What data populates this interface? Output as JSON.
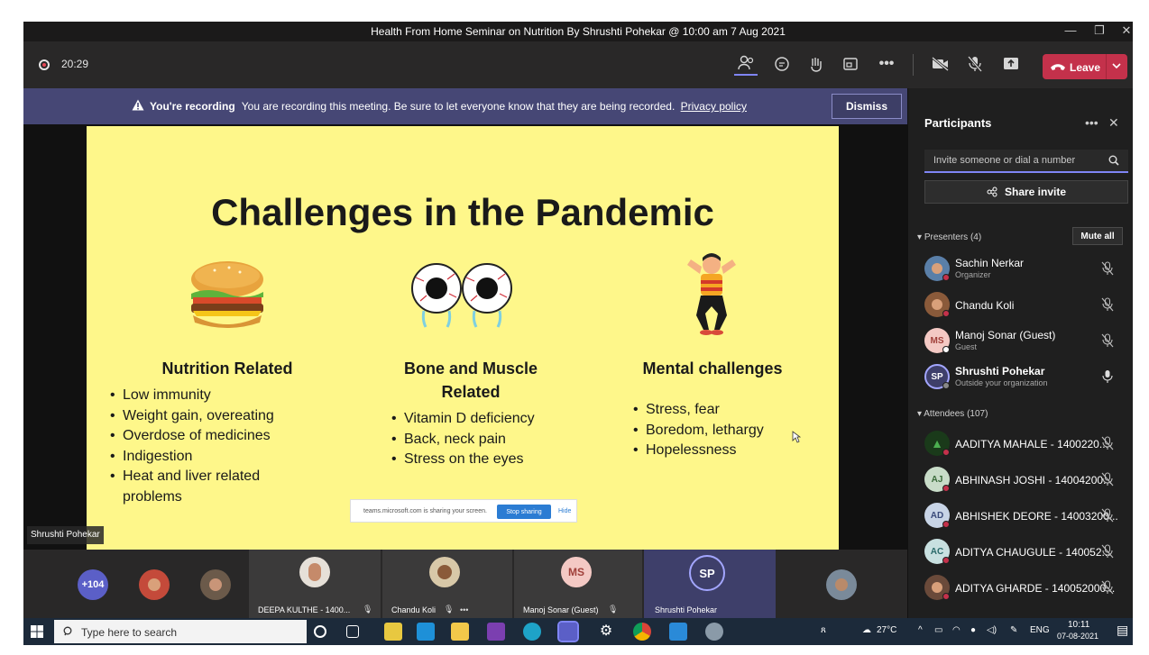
{
  "window": {
    "title": "Health From Home Seminar on Nutrition By Shrushti Pohekar @ 10:00 am 7 Aug 2021"
  },
  "toolbar": {
    "timer": "20:29",
    "icons": [
      "people-icon",
      "chat-icon",
      "reactions-icon",
      "rooms-icon",
      "more-icon",
      "camera-off-icon",
      "mic-off-icon",
      "share-tray-icon"
    ],
    "leave_label": "Leave",
    "leave_color": "#c4314b"
  },
  "recording_banner": {
    "heading": "You're recording",
    "message": "You are recording this meeting. Be sure to let everyone know that they are being recorded.",
    "link": "Privacy policy",
    "dismiss_label": "Dismiss"
  },
  "slide": {
    "title": "Challenges in the Pandemic",
    "background": "#fef78a",
    "columns": [
      {
        "heading": "Nutrition Related",
        "items": [
          "Low immunity",
          "Weight gain, overeating",
          "Overdose of medicines",
          "Indigestion",
          "Heat and liver related problems"
        ]
      },
      {
        "heading": "Bone and Muscle Related",
        "items": [
          "Vitamin D deficiency",
          "Back, neck pain",
          "Stress on the eyes"
        ]
      },
      {
        "heading": "Mental challenges",
        "items": [
          "Stress, fear",
          "Boredom, lethargy",
          "Hopelessness"
        ]
      }
    ],
    "share_bar": {
      "text": "teams.microsoft.com is sharing your screen.",
      "stop_label": "Stop sharing",
      "hide_label": "Hide"
    },
    "speaker_name": "Shrushti Pohekar"
  },
  "gallery": {
    "overflow_count": "+104",
    "tiles": [
      {
        "name": "DEEPA KULTHE - 1400..."
      },
      {
        "name": "Chandu Koli"
      },
      {
        "initials": "MS",
        "name": "Manoj Sonar (Guest)"
      },
      {
        "initials": "SP",
        "name": "Shrushti Pohekar"
      }
    ]
  },
  "participants": {
    "title": "Participants",
    "invite_placeholder": "Invite someone or dial a number",
    "share_invite_label": "Share invite",
    "presenters_label": "Presenters (4)",
    "mute_all_label": "Mute all",
    "presenters": [
      {
        "name": "Sachin Nerkar",
        "role": "Organizer",
        "avatar_color": "#5a7fa8"
      },
      {
        "name": "Chandu Koli",
        "role": "",
        "avatar_color": "#8a5a3a"
      },
      {
        "name": "Manoj Sonar (Guest)",
        "role": "Guest",
        "initials": "MS",
        "avatar_color": "#f4c9c4"
      },
      {
        "name": "Shrushti Pohekar",
        "role": "Outside your organization",
        "initials": "SP",
        "avatar_color": "#3e3f6a"
      }
    ],
    "attendees_label": "Attendees (107)",
    "attendees": [
      {
        "name": "AADITYA MAHALE - 1400220...",
        "initials": "",
        "avatar_color": "#1a3a1a"
      },
      {
        "name": "ABHINASH JOSHI - 14004200...",
        "initials": "AJ",
        "avatar_color": "#c8dcc8"
      },
      {
        "name": "ABHISHEK DEORE - 14003200...",
        "initials": "AD",
        "avatar_color": "#c8d4e6"
      },
      {
        "name": "ADITYA CHAUGULE - 140052...",
        "initials": "AC",
        "avatar_color": "#c8e0e0"
      },
      {
        "name": "ADITYA GHARDE - 140052000...",
        "initials": "",
        "avatar_color": "#6a4a3a"
      }
    ]
  },
  "taskbar": {
    "search_placeholder": "Type here to search",
    "temperature": "27°C",
    "language": "ENG",
    "time": "10:11",
    "date": "07-08-2021"
  }
}
